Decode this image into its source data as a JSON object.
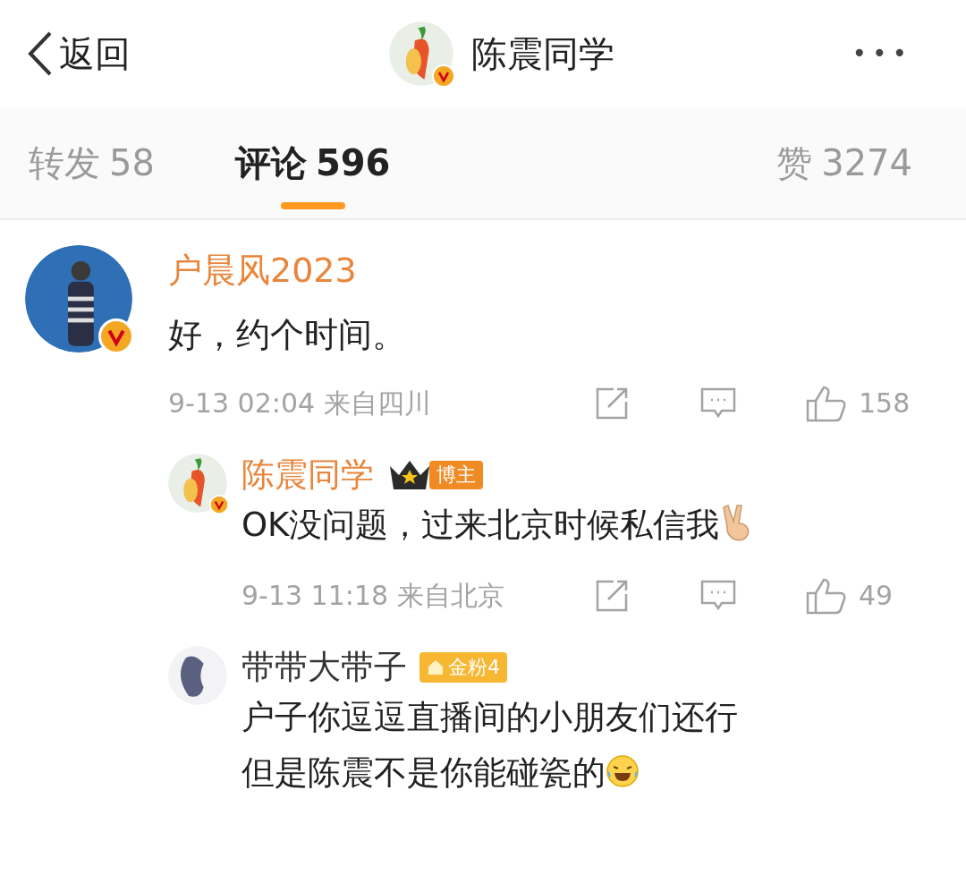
{
  "header": {
    "back_label": "返回",
    "title": "陈震同学",
    "verified": true,
    "more": "•••"
  },
  "tabs": [
    {
      "label": "转发",
      "count": "58",
      "selected": false
    },
    {
      "label": "评论",
      "count": "596",
      "selected": true
    },
    {
      "label": "赞",
      "count": "3274",
      "selected": false
    }
  ],
  "comments": [
    {
      "name": "户晨风2023",
      "verified": true,
      "body": [
        "好，约个时间。"
      ],
      "date": "9-13 02:04 来自四川",
      "likes": "158",
      "replies": [
        {
          "name": "陈震同学",
          "color": "#e8853a",
          "verified": true,
          "badge": {
            "kind": "host",
            "label": "博主"
          },
          "body": [
            "OK没问题，过来北京时候私信我"
          ],
          "emoji": {
            "kind": "victory"
          },
          "date": "9-13 11:18 来自北京",
          "likes": "49"
        },
        {
          "name": "带带大带子",
          "color": "#333333",
          "verified": false,
          "badge": {
            "kind": "fan",
            "label": "金粉4"
          },
          "body": [
            "户子你逗逗直播间的小朋友们还行",
            "但是陈震不是你能碰瓷的"
          ],
          "emoji": {
            "kind": "laughing"
          }
        }
      ]
    }
  ]
}
